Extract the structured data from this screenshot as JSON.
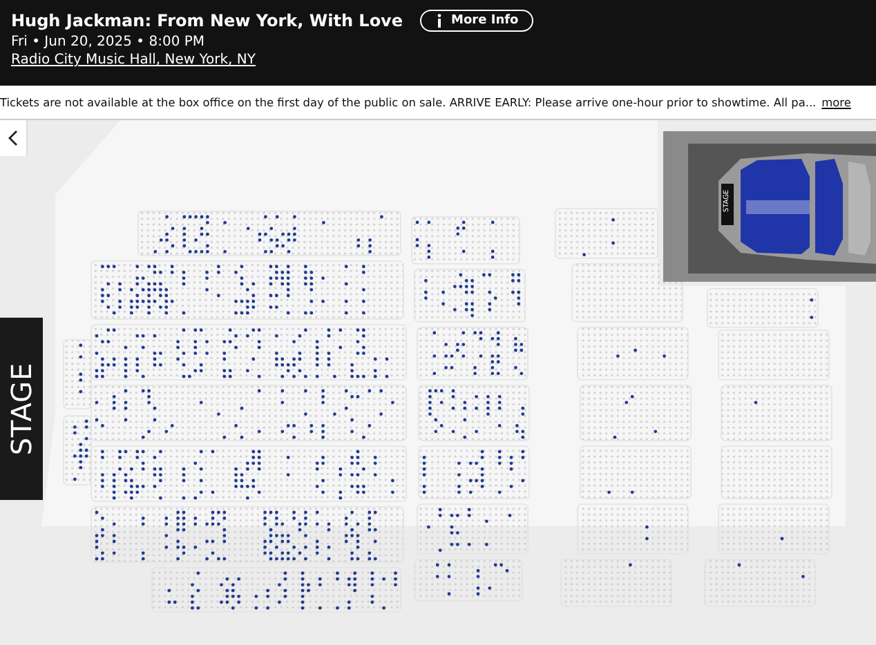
{
  "event": {
    "title": "Hugh Jackman: From New York, With Love",
    "more_info": "More Info",
    "date": "Fri • Jun 20, 2025 • 8:00 PM",
    "venue": "Radio City Music Hall, New York, NY"
  },
  "notice": {
    "text": "Tickets are not available at the box office on the first day of the public on sale. ARRIVE EARLY: Please arrive one-hour prior to showtime. All pa...",
    "link": "more"
  },
  "seat_map": {
    "stage_label": "STAGE",
    "minimap": {
      "stage_label": "STAGE"
    }
  }
}
